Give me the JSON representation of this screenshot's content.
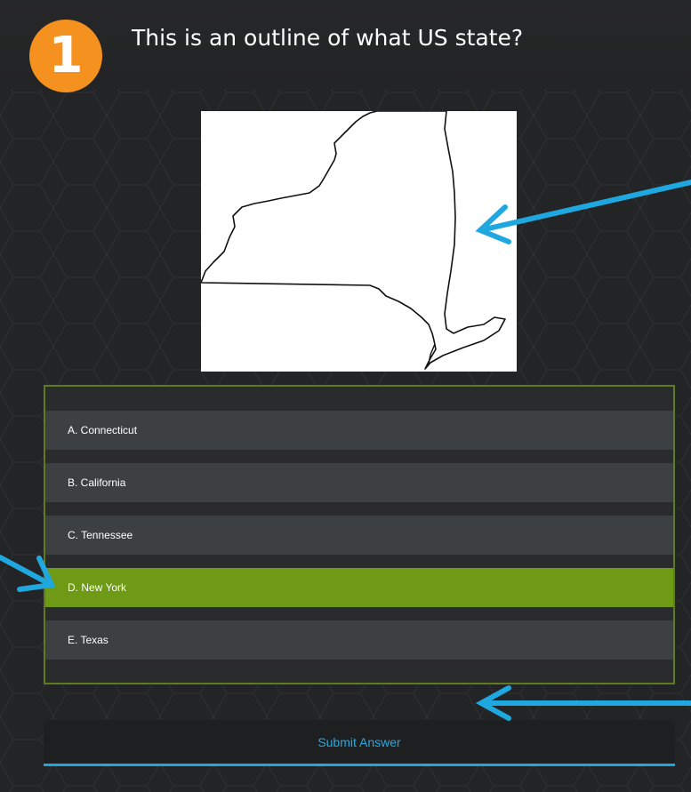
{
  "question": {
    "number": "1",
    "text": "This is an outline of what US state?"
  },
  "map": {
    "icon": "new-york-state-outline"
  },
  "options": [
    {
      "label": "A. Connecticut",
      "selected": false
    },
    {
      "label": "B. California",
      "selected": false
    },
    {
      "label": "C. Tennessee",
      "selected": false
    },
    {
      "label": "D. New York",
      "selected": true
    },
    {
      "label": "E. Texas",
      "selected": false
    }
  ],
  "submit": {
    "label": "Submit Answer"
  },
  "colors": {
    "background": "#232425",
    "badge": "#f5911e",
    "option": "#3d4043",
    "selected": "#6e9a15",
    "frame": "#5f7a1f",
    "accent": "#1fa8e0"
  }
}
